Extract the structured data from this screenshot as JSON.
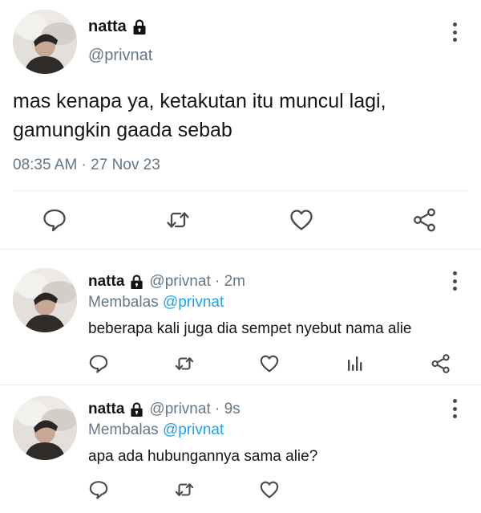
{
  "main_tweet": {
    "display_name": "natta",
    "handle": "@privnat",
    "text": "mas kenapa ya, ketakutan itu muncul lagi, gamungkin gaada sebab",
    "timestamp": "08:35 AM · 27 Nov 23",
    "icons": [
      "lock-icon",
      "more-icon",
      "reply-icon",
      "retweet-icon",
      "like-icon",
      "share-icon"
    ]
  },
  "replies": [
    {
      "display_name": "natta",
      "handle_time": "@privnat · 2m",
      "replying_prefix": "Membalas",
      "replying_to": "@privnat",
      "text": "beberapa kali juga dia sempet nyebut nama alie",
      "icons": [
        "reply-icon",
        "retweet-icon",
        "like-icon",
        "analytics-icon",
        "share-icon"
      ]
    },
    {
      "display_name": "natta",
      "handle_time": "@privnat · 9s",
      "replying_prefix": "Membalas",
      "replying_to": "@privnat",
      "text": "apa ada hubungannya sama alie?",
      "icons": [
        "reply-icon",
        "retweet-icon",
        "like-icon"
      ]
    }
  ],
  "colors": {
    "text": "#0f1419",
    "muted": "#657786",
    "link": "#1da1f2",
    "icon": "#4a4a4a",
    "divider": "#e6ecf0"
  }
}
